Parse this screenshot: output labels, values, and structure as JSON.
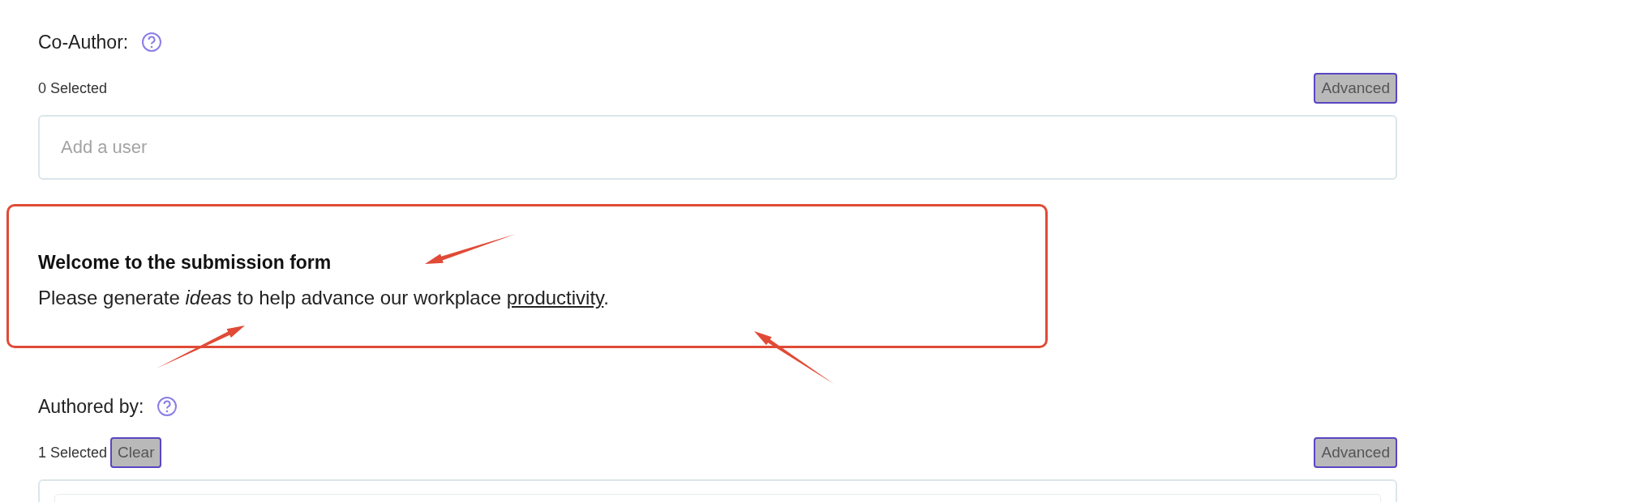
{
  "co_author": {
    "label": "Co-Author:",
    "count": "0 Selected",
    "advanced_button": "Advanced",
    "input": {
      "placeholder": "Add a user"
    }
  },
  "welcome": {
    "heading": "Welcome to the submission form",
    "text_before": "Please generate *ideas* to help advance our workplace ",
    "link": "productivity",
    "text_after": "."
  },
  "authored_by": {
    "label": "Authored by:",
    "count": "1 Selected",
    "clear_button": "Clear",
    "advanced_button": "Advanced"
  }
}
